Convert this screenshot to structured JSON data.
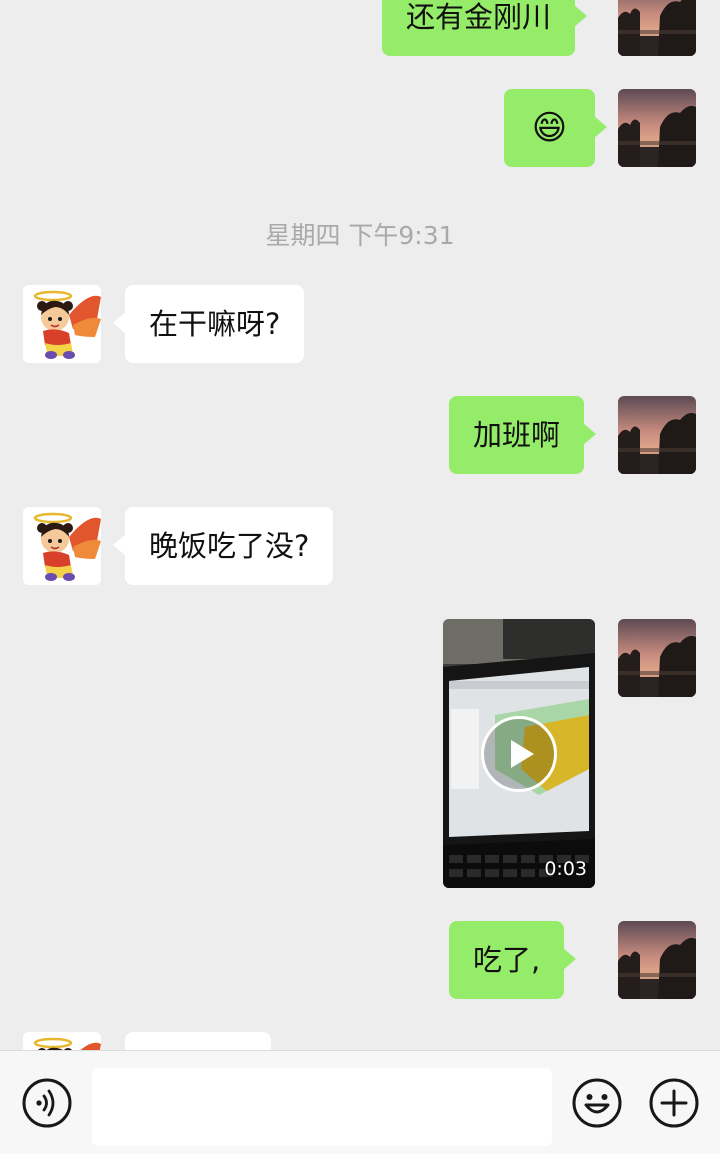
{
  "timestamp": "星期四 下午9:31",
  "messages": {
    "m1": "还有金刚川",
    "m2": "😄",
    "m3": "在干嘛呀?",
    "m4": "加班啊",
    "m5": "晚饭吃了没?",
    "m7": "吃了,"
  },
  "video": {
    "duration": "0:03"
  },
  "input": {
    "placeholder": ""
  },
  "icons": {
    "voice": "voice-icon",
    "emoji": "emoji-icon",
    "plus": "plus-icon",
    "play": "play-icon"
  },
  "colors": {
    "my_bubble": "#95ec69",
    "other_bubble": "#ffffff",
    "background": "#ededed"
  }
}
